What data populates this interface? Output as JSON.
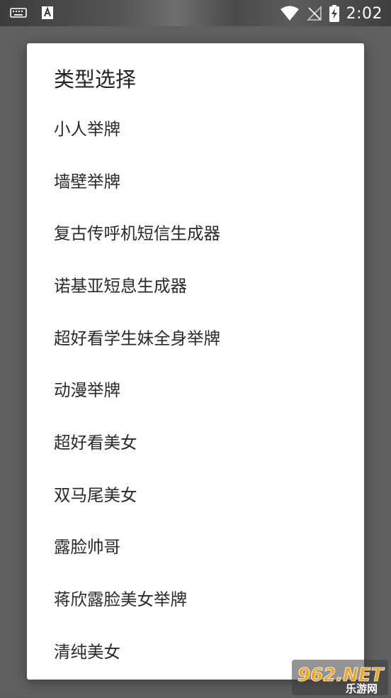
{
  "status_bar": {
    "time": "2:02",
    "left_icons": [
      "keyboard-icon",
      "a-notification-icon"
    ],
    "right_icons": [
      "wifi-icon",
      "no-sim-icon",
      "battery-charging-icon"
    ]
  },
  "dialog": {
    "title": "类型选择",
    "options": [
      "小人举牌",
      "墙壁举牌",
      "复古传呼机短信生成器",
      "诺基亚短息生成器",
      "超好看学生妹全身举牌",
      "动漫举牌",
      "超好看美女",
      "双马尾美女",
      "露脸帅哥",
      "蒋欣露脸美女举牌",
      "清纯美女"
    ]
  },
  "watermark": {
    "brand": "962.NET",
    "subtitle": "乐游网"
  },
  "colors": {
    "backdrop": "#5f5f5f",
    "dialog_bg": "#ffffff",
    "text_primary": "#2a2a2a",
    "watermark_orange": "#f5a21b"
  }
}
